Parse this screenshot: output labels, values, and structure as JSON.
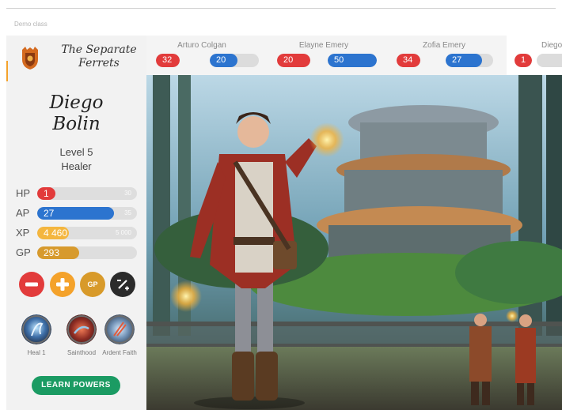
{
  "header": {
    "class_label": "Demo class"
  },
  "team": {
    "name_line1": "The Separate",
    "name_line2": "Ferrets"
  },
  "character": {
    "first_name": "Diego",
    "last_name": "Bolin",
    "level": "Level 5",
    "class": "Healer"
  },
  "stats": [
    {
      "label": "HP",
      "value": "1",
      "max": "30",
      "fraction": 0.03,
      "color": "#e23b3b"
    },
    {
      "label": "AP",
      "value": "27",
      "max": "35",
      "fraction": 0.77,
      "color": "#2c74cf"
    },
    {
      "label": "XP",
      "value": "4 460",
      "max": "5 000",
      "fraction": 0.32,
      "color": "#f4b63f"
    },
    {
      "label": "GP",
      "value": "293",
      "max": "",
      "fraction": 0.42,
      "color": "#d79a2d"
    }
  ],
  "actions": [
    {
      "name": "minus-button",
      "icon": "minus-icon",
      "color": "#e23b3b"
    },
    {
      "name": "plus-button",
      "icon": "plus-icon",
      "color": "#f4a22b"
    },
    {
      "name": "gold-button",
      "label": "GP",
      "color": "#d89a2a"
    },
    {
      "name": "multiplier-button",
      "icon": "percent-icon",
      "color": "#2b2b2b"
    }
  ],
  "powers": [
    {
      "label": "Heal 1"
    },
    {
      "label": "Sainthood"
    },
    {
      "label": "Ardent Faith"
    }
  ],
  "learn_powers_label": "LEARN POWERS",
  "party": [
    {
      "name": "Arturo Colgan",
      "hp": "32",
      "ap": "20",
      "hp_fraction": 1.0,
      "ap_fraction": 0.57
    },
    {
      "name": "Elayne Emery",
      "hp": "20",
      "ap": "50",
      "hp_fraction": 1.0,
      "ap_fraction": 1.0
    },
    {
      "name": "Zofia Emery",
      "hp": "34",
      "ap": "27",
      "hp_fraction": 1.0,
      "ap_fraction": 0.77
    },
    {
      "name": "Diego Bolin",
      "hp": "1",
      "ap": "",
      "hp_fraction": 1.0,
      "ap_fraction": 0.0
    }
  ],
  "colors": {
    "hp": "#e23b3b",
    "ap": "#2c74cf",
    "accent": "#f4a22b",
    "learn": "#1b9b63"
  }
}
